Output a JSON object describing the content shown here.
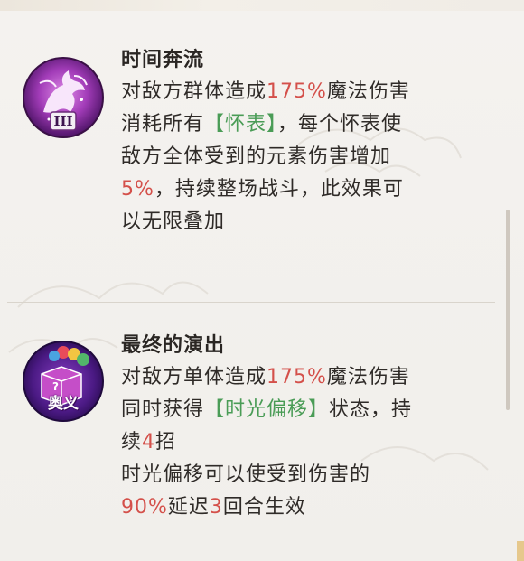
{
  "skills": [
    {
      "name": "时间奔流",
      "badge": "III",
      "icon": "unicorn-swirl-icon",
      "lines": [
        [
          {
            "t": "对敌方群体造成",
            "c": "n"
          },
          {
            "t": "175%",
            "c": "r"
          },
          {
            "t": "魔法伤害",
            "c": "n"
          }
        ],
        [
          {
            "t": "消耗所有",
            "c": "n"
          },
          {
            "t": "【怀表】",
            "c": "g"
          },
          {
            "t": "，每个怀表使",
            "c": "n"
          }
        ],
        [
          {
            "t": "敌方全体受到的元素伤害增加",
            "c": "n"
          }
        ],
        [
          {
            "t": "5%",
            "c": "r"
          },
          {
            "t": "，持续整场战斗，此效果可",
            "c": "n"
          }
        ],
        [
          {
            "t": "以无限叠加",
            "c": "n"
          }
        ]
      ]
    },
    {
      "name": "最终的演出",
      "badge": "奥义",
      "icon": "mystery-box-balloons-icon",
      "lines": [
        [
          {
            "t": "对敌方单体造成",
            "c": "n"
          },
          {
            "t": "175%",
            "c": "r"
          },
          {
            "t": "魔法伤害",
            "c": "n"
          }
        ],
        [
          {
            "t": "同时获得",
            "c": "n"
          },
          {
            "t": "【时光偏移】",
            "c": "g"
          },
          {
            "t": "状态，持",
            "c": "n"
          }
        ],
        [
          {
            "t": "续",
            "c": "n"
          },
          {
            "t": "4",
            "c": "r"
          },
          {
            "t": "招",
            "c": "n"
          }
        ],
        [
          {
            "t": "时光偏移可以使受到伤害的",
            "c": "n"
          }
        ],
        [
          {
            "t": "90%",
            "c": "r"
          },
          {
            "t": "延迟",
            "c": "n"
          },
          {
            "t": "3",
            "c": "r"
          },
          {
            "t": "回合生效",
            "c": "n"
          }
        ]
      ]
    }
  ],
  "colors": {
    "highlight_red": "#d4504a",
    "highlight_green": "#4a9c56",
    "text": "#2f2b28"
  }
}
